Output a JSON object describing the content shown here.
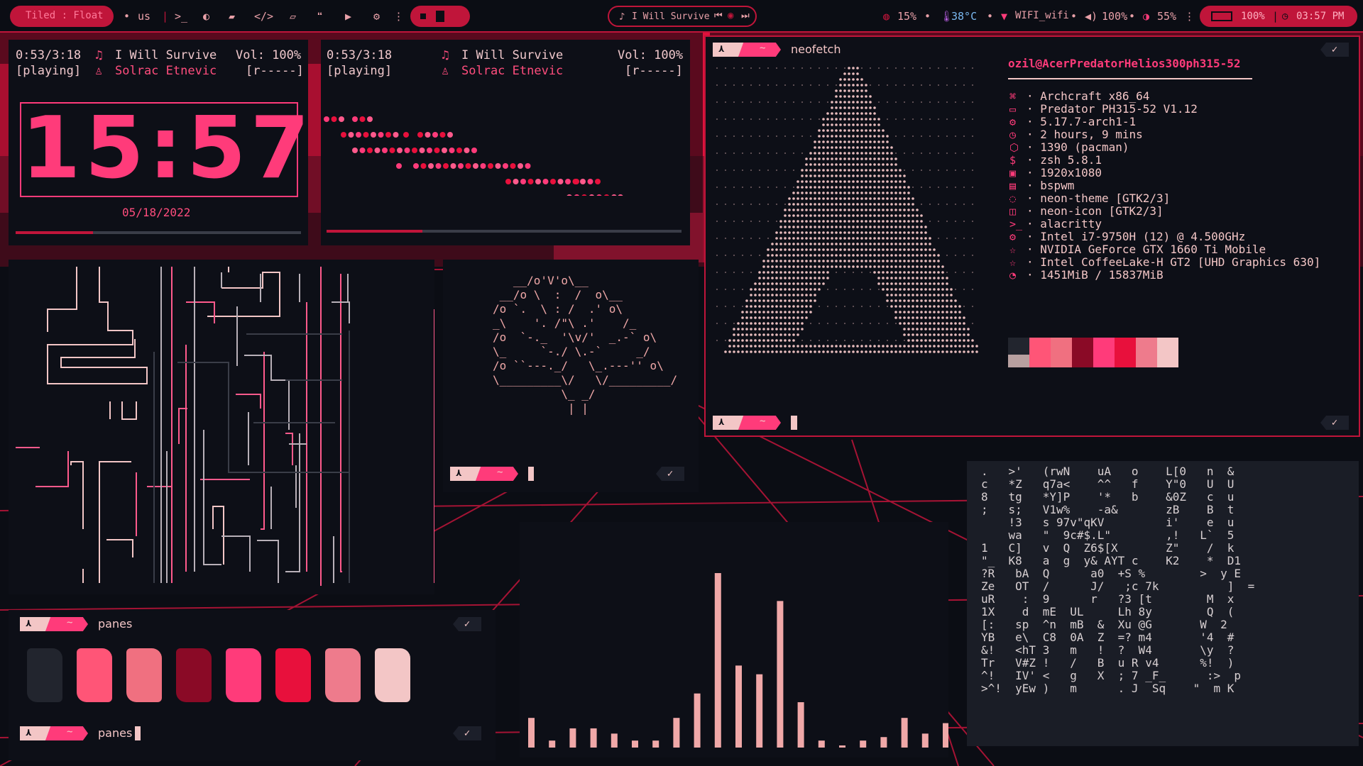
{
  "topbar": {
    "layout_label": "Tiled : Float",
    "keyboard": "us",
    "music_title": "I Will Survive",
    "cpu": "15%",
    "temp": "38°C",
    "wifi": "WIFI_wifi",
    "volume": "100%",
    "brightness": "55%",
    "battery": "100%",
    "clock": "03:57 PM"
  },
  "music1": {
    "time": "0:53/3:18",
    "status": "[playing]",
    "title": "I Will Survive",
    "artist": "Solrac Etnevic",
    "vol": "Vol: 100%",
    "flags": "[r-----]",
    "clock": "15:57",
    "date": "05/18/2022",
    "progress": 0.27
  },
  "music2": {
    "time": "0:53/3:18",
    "status": "[playing]",
    "title": "I Will Survive",
    "artist": "Solrac Etnevic",
    "vol": "Vol: 100%",
    "flags": "[r-----]",
    "progress": 0.27
  },
  "neofetch": {
    "command": "neofetch",
    "userhost": "ozil@AcerPredatorHelios300ph315-52",
    "rows": [
      "· Archcraft x86_64",
      "· Predator PH315-52 V1.12",
      "· 5.17.7-arch1-1",
      "· 2 hours, 9 mins",
      "· 1390 (pacman)",
      "· zsh 5.8.1",
      "· 1920x1080",
      "· bspwm",
      "· neon-theme [GTK2/3]",
      "· neon-icon [GTK2/3]",
      "· alacritty",
      "· Intel i7-9750H (12) @ 4.500GHz",
      "· NVIDIA GeForce GTX 1660 Ti Mobile",
      "· Intel CoffeeLake-H GT2 [UHD Graphics 630]",
      "· 1451MiB / 15837MiB"
    ],
    "row_icons": [
      "⌘",
      "▭",
      "⚙",
      "◷",
      "⬡",
      "$",
      "▣",
      "▤",
      "◌",
      "◫",
      ">_",
      "⚙",
      "☆",
      "☆",
      "◔"
    ]
  },
  "panes": {
    "command1": "panes",
    "command2": "panes",
    "swatches": [
      "#22252e",
      "#ff5577",
      "#f07080",
      "#8a0a26",
      "#ff3b7a",
      "#e8103c",
      "#ee7b8c",
      "#f3c6c6"
    ]
  },
  "colors": {
    "accent": "#c0153a",
    "pink": "#ff3b7a",
    "pale": "#f3c6c6",
    "bg": "#0d0f17",
    "bars": "#f0a8a8"
  },
  "visualizer": {
    "values": [
      0.17,
      0.04,
      0.11,
      0.11,
      0.08,
      0.04,
      0.04,
      0.17,
      0.31,
      1.0,
      0.47,
      0.42,
      0.84,
      0.26,
      0.04,
      0.01,
      0.04,
      0.06,
      0.17,
      0.08,
      0.14
    ]
  },
  "neofetch_palette": [
    "#22252e",
    "#b8a0a0",
    "#ff5577",
    "#f07080",
    "#8a0a26",
    "#ff3b7a",
    "#e8103c",
    "#ee7b8c",
    "#f3c6c6"
  ],
  "tree_art": [
    "   __/o'V'o\\__",
    " __/o \\  :  /  o\\__",
    "/o `.  \\ : /  .' o\\",
    "_\\    '. /\"\\ .'    /_",
    "/o  `-._  '\\v/'  _.-` o\\",
    "\\_     `-./ \\.-`     _/",
    "/o ``---._/   \\_.---'' o\\",
    "\\_________\\/   \\/_________/",
    "          \\_ _/",
    "           | |"
  ]
}
